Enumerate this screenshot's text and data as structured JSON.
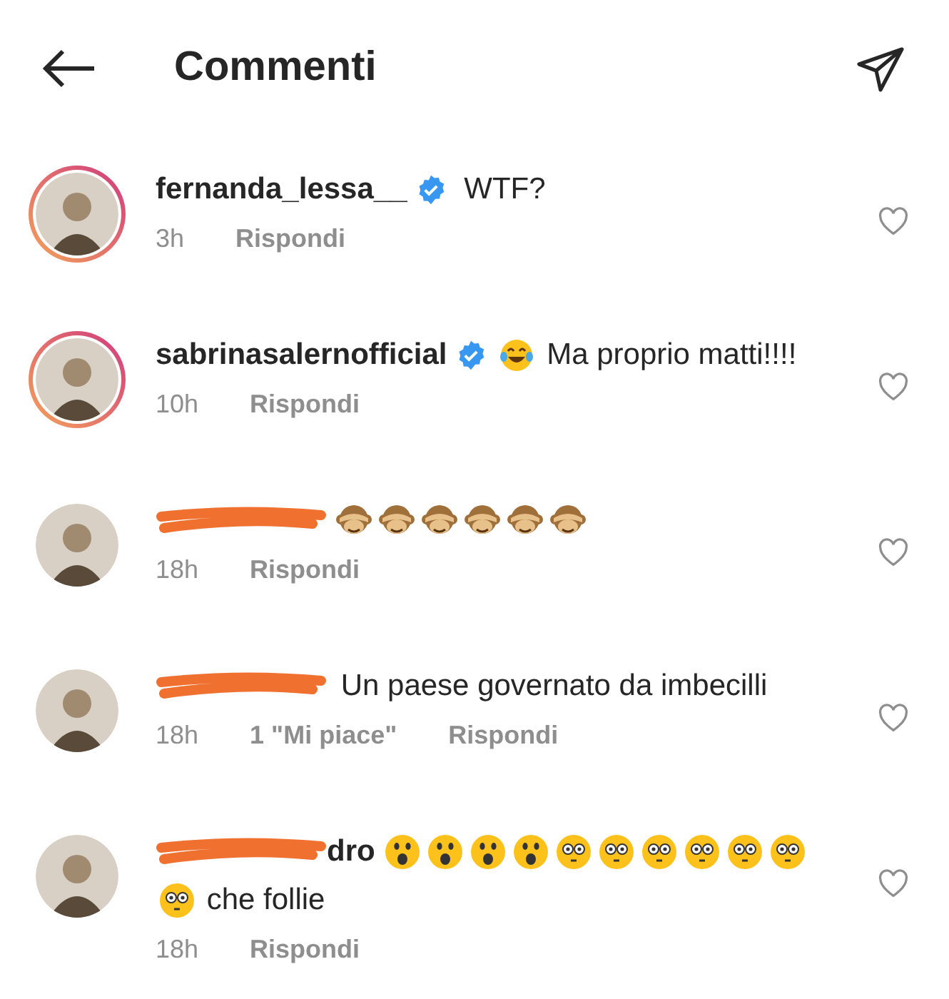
{
  "header": {
    "title": "Commenti"
  },
  "comments": [
    {
      "username": "fernanda_lessa__",
      "redacted": false,
      "verified": true,
      "story_ring": true,
      "body": [
        {
          "kind": "text",
          "text": "WTF?"
        }
      ],
      "time": "3h",
      "reply": "Rispondi",
      "liked": false
    },
    {
      "username": "sabrinasalernofficial",
      "redacted": false,
      "verified": true,
      "story_ring": true,
      "body": [
        {
          "kind": "laughing"
        },
        {
          "kind": "text",
          "text": "Ma proprio matti!!!!"
        }
      ],
      "time": "10h",
      "reply": "Rispondi",
      "liked": false
    },
    {
      "redacted": true,
      "verified": false,
      "story_ring": false,
      "body": [
        {
          "kind": "monkey"
        },
        {
          "kind": "monkey"
        },
        {
          "kind": "monkey"
        },
        {
          "kind": "monkey"
        },
        {
          "kind": "monkey"
        },
        {
          "kind": "monkey"
        }
      ],
      "time": "18h",
      "reply": "Rispondi",
      "liked": false
    },
    {
      "redacted": true,
      "verified": false,
      "story_ring": false,
      "body": [
        {
          "kind": "text",
          "text": "Un paese governato da imbecilli"
        }
      ],
      "time": "18h",
      "likes": "1 \"Mi piace\"",
      "reply": "Rispondi",
      "liked": false
    },
    {
      "redacted": true,
      "username_tail": "dro",
      "verified": false,
      "story_ring": false,
      "body": [
        {
          "kind": "astonished"
        },
        {
          "kind": "astonished"
        },
        {
          "kind": "astonished"
        },
        {
          "kind": "astonished"
        },
        {
          "kind": "flushed"
        },
        {
          "kind": "flushed"
        },
        {
          "kind": "flushed"
        },
        {
          "kind": "flushed"
        },
        {
          "kind": "flushed"
        },
        {
          "kind": "flushed"
        },
        {
          "kind": "flushed"
        },
        {
          "kind": "text",
          "text": "che follie"
        }
      ],
      "time": "18h",
      "reply": "Rispondi",
      "liked": false
    }
  ]
}
